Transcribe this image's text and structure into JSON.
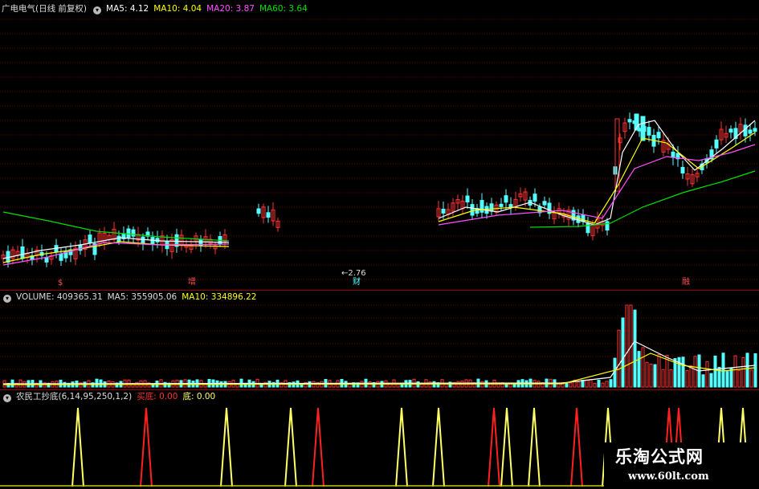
{
  "price_header": {
    "stock": "广电电气(日线 前复权)",
    "ma5": "MA5: 4.12",
    "ma10": "MA10: 4.04",
    "ma20": "MA20: 3.87",
    "ma60": "MA60: 3.64"
  },
  "volume_header": {
    "label": "VOLUME: 409365.31",
    "ma5": "MA5: 355905.06",
    "ma10": "MA10: 334896.22"
  },
  "indicator_header": {
    "name": "农民工抄底(6,14,95,250,1,2)",
    "buy": "买底: 0.00",
    "bottom": "底: 0.00"
  },
  "markers": {
    "m1": "$",
    "m2": "增",
    "m3": "财",
    "m4": "融",
    "low_price": "←2.76"
  },
  "watermark": {
    "title": "乐淘公式网",
    "url": "www.60lt.com"
  },
  "colors": {
    "up": "#ff3232",
    "down": "#54ffff",
    "ma5": "#ffffff",
    "ma10": "#ffff00",
    "ma20": "#ff50ff",
    "ma60": "#00e000",
    "grid": "#8b0000",
    "spike_yellow": "#ffff66",
    "spike_red": "#ff2020"
  }
}
